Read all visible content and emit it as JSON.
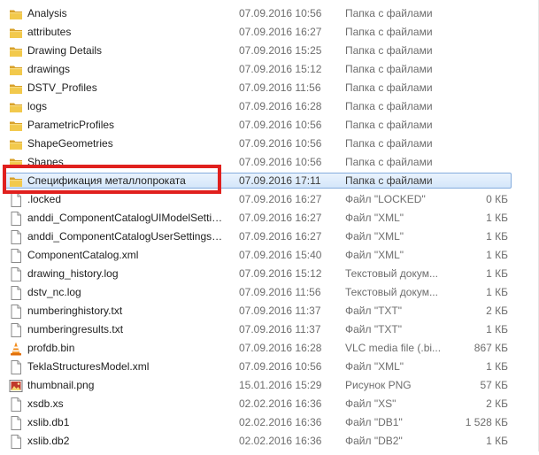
{
  "files": [
    {
      "name": "Analysis",
      "date": "07.09.2016 10:56",
      "type": "Папка с файлами",
      "size": "",
      "icon": "folder-icon"
    },
    {
      "name": "attributes",
      "date": "07.09.2016 16:27",
      "type": "Папка с файлами",
      "size": "",
      "icon": "folder-icon"
    },
    {
      "name": "Drawing Details",
      "date": "07.09.2016 15:25",
      "type": "Папка с файлами",
      "size": "",
      "icon": "folder-icon"
    },
    {
      "name": "drawings",
      "date": "07.09.2016 15:12",
      "type": "Папка с файлами",
      "size": "",
      "icon": "folder-icon"
    },
    {
      "name": "DSTV_Profiles",
      "date": "07.09.2016 11:56",
      "type": "Папка с файлами",
      "size": "",
      "icon": "folder-icon"
    },
    {
      "name": "logs",
      "date": "07.09.2016 16:28",
      "type": "Папка с файлами",
      "size": "",
      "icon": "folder-icon"
    },
    {
      "name": "ParametricProfiles",
      "date": "07.09.2016 10:56",
      "type": "Папка с файлами",
      "size": "",
      "icon": "folder-icon"
    },
    {
      "name": "ShapeGeometries",
      "date": "07.09.2016 10:56",
      "type": "Папка с файлами",
      "size": "",
      "icon": "folder-icon"
    },
    {
      "name": "Shapes",
      "date": "07.09.2016 10:56",
      "type": "Папка с файлами",
      "size": "",
      "icon": "folder-icon"
    },
    {
      "name": "Спецификация металлопроката",
      "date": "07.09.2016 17:11",
      "type": "Папка с файлами",
      "size": "",
      "icon": "folder-icon",
      "selected": true
    },
    {
      "name": ".locked",
      "date": "07.09.2016 16:27",
      "type": "Файл \"LOCKED\"",
      "size": "0 КБ",
      "icon": "file-icon"
    },
    {
      "name": "anddi_ComponentCatalogUIModelSettin...",
      "date": "07.09.2016 16:27",
      "type": "Файл \"XML\"",
      "size": "1 КБ",
      "icon": "file-icon"
    },
    {
      "name": "anddi_ComponentCatalogUserSettings.x...",
      "date": "07.09.2016 16:27",
      "type": "Файл \"XML\"",
      "size": "1 КБ",
      "icon": "file-icon"
    },
    {
      "name": "ComponentCatalog.xml",
      "date": "07.09.2016 15:40",
      "type": "Файл \"XML\"",
      "size": "1 КБ",
      "icon": "file-icon"
    },
    {
      "name": "drawing_history.log",
      "date": "07.09.2016 15:12",
      "type": "Текстовый докум...",
      "size": "1 КБ",
      "icon": "file-icon"
    },
    {
      "name": "dstv_nc.log",
      "date": "07.09.2016 11:56",
      "type": "Текстовый докум...",
      "size": "1 КБ",
      "icon": "file-icon"
    },
    {
      "name": "numberinghistory.txt",
      "date": "07.09.2016 11:37",
      "type": "Файл \"TXT\"",
      "size": "2 КБ",
      "icon": "file-icon"
    },
    {
      "name": "numberingresults.txt",
      "date": "07.09.2016 11:37",
      "type": "Файл \"TXT\"",
      "size": "1 КБ",
      "icon": "file-icon"
    },
    {
      "name": "profdb.bin",
      "date": "07.09.2016 16:28",
      "type": "VLC media file (.bi...",
      "size": "867 КБ",
      "icon": "vlc-cone-icon"
    },
    {
      "name": "TeklaStructuresModel.xml",
      "date": "07.09.2016 10:56",
      "type": "Файл \"XML\"",
      "size": "1 КБ",
      "icon": "file-icon"
    },
    {
      "name": "thumbnail.png",
      "date": "15.01.2016 15:29",
      "type": "Рисунок PNG",
      "size": "57 КБ",
      "icon": "image-icon"
    },
    {
      "name": "xsdb.xs",
      "date": "02.02.2016 16:36",
      "type": "Файл \"XS\"",
      "size": "2 КБ",
      "icon": "file-icon"
    },
    {
      "name": "xslib.db1",
      "date": "02.02.2016 16:36",
      "type": "Файл \"DB1\"",
      "size": "1 528 КБ",
      "icon": "file-icon"
    },
    {
      "name": "xslib.db2",
      "date": "02.02.2016 16:36",
      "type": "Файл \"DB2\"",
      "size": "1 КБ",
      "icon": "file-icon"
    }
  ],
  "colors": {
    "highlight_box": "#e0201e",
    "folder": "#e8b93d",
    "selection_border": "#84acdd"
  }
}
